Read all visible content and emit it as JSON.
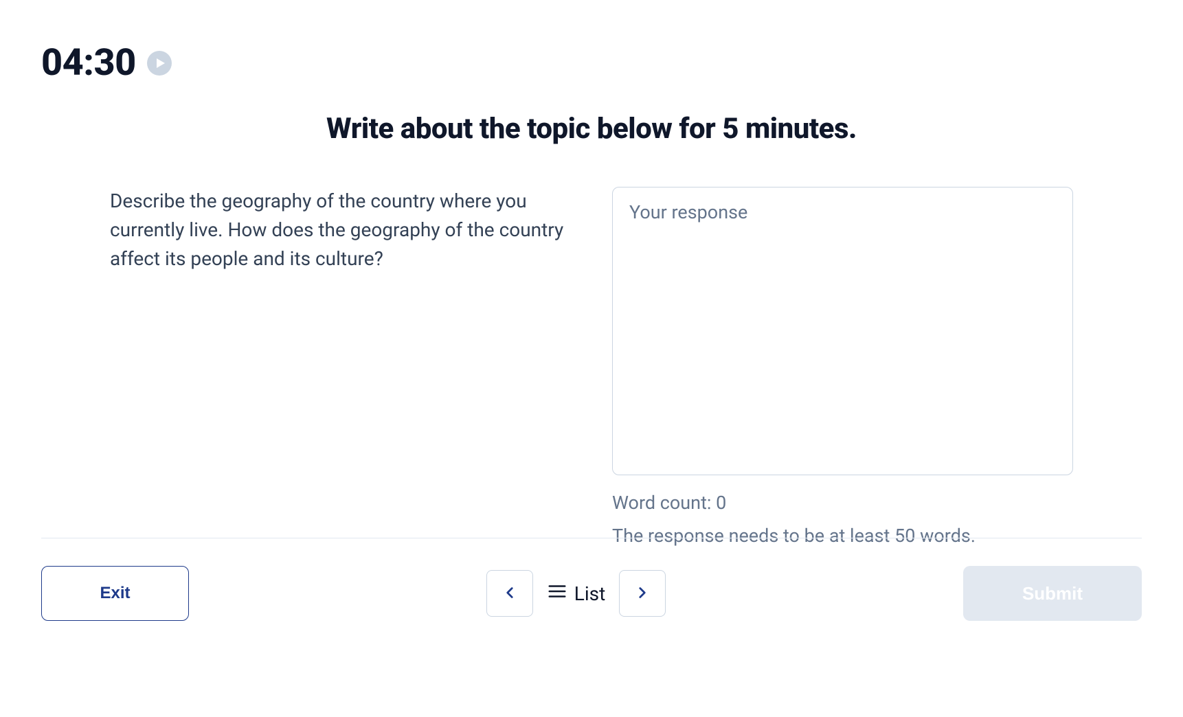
{
  "timer": "04:30",
  "instruction": "Write about the topic below for 5 minutes.",
  "prompt": "Describe the geography of the country where you currently live. How does the geography of the country affect its people and its culture?",
  "response": {
    "placeholder": "Your response",
    "value": ""
  },
  "word_count_label": "Word count: 0",
  "min_words_label": "The response needs to be at least 50 words.",
  "footer": {
    "exit_label": "Exit",
    "list_label": "List",
    "submit_label": "Submit"
  }
}
